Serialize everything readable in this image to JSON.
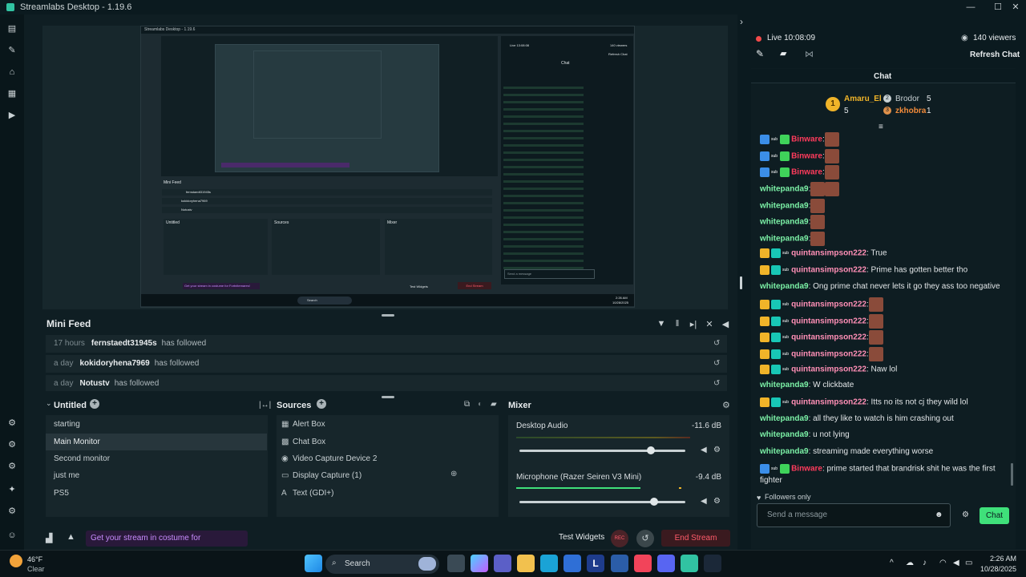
{
  "window": {
    "title": "Streamlabs Desktop - 1.19.6"
  },
  "nested": {
    "title": "Streamlabs Desktop - 1.19.6",
    "mini_feed": "Mini Feed",
    "row_user": "fernstaedt31945s",
    "row_user2": "kokidoryhena7969",
    "row_user3": "Notustv",
    "sources": "Sources",
    "mixer": "Mixer",
    "untitled": "Untitled",
    "promo": "Get your stream in costume for Fortnitemares!",
    "test_widgets": "Test Widgets",
    "end_stream": "End Stream",
    "send": "Send a message",
    "chat": "Chat",
    "search": "Search",
    "live": "Live 13:08:08",
    "viewers": "140 viewers",
    "refresh": "Refresh Chat",
    "tb_time": "2:26 AM",
    "tb_date": "10/28/2025"
  },
  "minifeed": {
    "title": "Mini Feed",
    "rows": [
      {
        "time": "17 hours",
        "user": "fernstaedt31945s",
        "action": "has followed"
      },
      {
        "time": "a day",
        "user": "kokidoryhena7969",
        "action": "has followed"
      },
      {
        "time": "a day",
        "user": "Notustv",
        "action": "has followed"
      }
    ]
  },
  "scenes": {
    "title": "Untitled",
    "items": [
      "starting",
      "Main Monitor",
      "Second monitor",
      "just me",
      "PS5"
    ],
    "selected": "Main Monitor"
  },
  "sources": {
    "title": "Sources",
    "items": [
      "Alert Box",
      "Chat Box",
      "Video Capture Device 2",
      "Display Capture (1)",
      "Text (GDI+)"
    ]
  },
  "mixer": {
    "title": "Mixer",
    "channels": [
      {
        "name": "Desktop Audio",
        "db": "-11.6 dB",
        "level": 0.79
      },
      {
        "name": "Microphone (Razer Seiren V3 Mini)",
        "db": "-9.4 dB",
        "level": 0.81
      }
    ]
  },
  "footer": {
    "promo": "Get your stream in costume for Fortnitemares!",
    "test_widgets": "Test Widgets",
    "rec": "REC",
    "end_stream": "End Stream"
  },
  "chat": {
    "live": "Live 10:08:09",
    "viewers": "140 viewers",
    "refresh": "Refresh Chat",
    "title": "Chat",
    "leaderboard": {
      "first": {
        "name": "Amaru_El",
        "count": "5"
      },
      "second": {
        "name": "Brodor",
        "count": "5"
      },
      "third": {
        "name": "zkhobra",
        "count": "1"
      }
    },
    "followers_only": "Followers only",
    "placeholder": "Send a message",
    "send": "Chat",
    "messages": [
      {
        "user": "Binware",
        "text": ":"
      },
      {
        "user": "Binware",
        "text": ":"
      },
      {
        "user": "Binware",
        "text": ":"
      },
      {
        "user": "whitepanda9",
        "text": ":"
      },
      {
        "user": "whitepanda9",
        "text": ":"
      },
      {
        "user": "whitepanda9",
        "text": ":"
      },
      {
        "user": "whitepanda9",
        "text": ":"
      },
      {
        "user": "quintansimpson222",
        "text": ": True"
      },
      {
        "user": "quintansimpson222",
        "text": ": Prime has gotten better tho"
      },
      {
        "user": "whitepanda9",
        "text": ": Ong prime chat never lets it go they ass too negative"
      },
      {
        "user": "quintansimpson222",
        "text": ":"
      },
      {
        "user": "quintansimpson222",
        "text": ":"
      },
      {
        "user": "quintansimpson222",
        "text": ":"
      },
      {
        "user": "quintansimpson222",
        "text": ":"
      },
      {
        "user": "quintansimpson222",
        "text": ": Naw lol"
      },
      {
        "user": "whitepanda9",
        "text": ": W clickbate"
      },
      {
        "user": "quintansimpson222",
        "text": ": Itts no its not cj they wild lol"
      },
      {
        "user": "whitepanda9",
        "text": ": all they like to watch is him crashing out"
      },
      {
        "user": "whitepanda9",
        "text": ": u not lying"
      },
      {
        "user": "whitepanda9",
        "text": ": streaming made everything worse"
      },
      {
        "user": "Binware",
        "text": ": prime started that brandrisk shit he was the first fighter"
      }
    ]
  },
  "taskbar": {
    "weather_temp": "46°F",
    "weather_desc": "Clear",
    "search": "Search",
    "time": "2:26 AM",
    "date": "10/28/2025"
  }
}
